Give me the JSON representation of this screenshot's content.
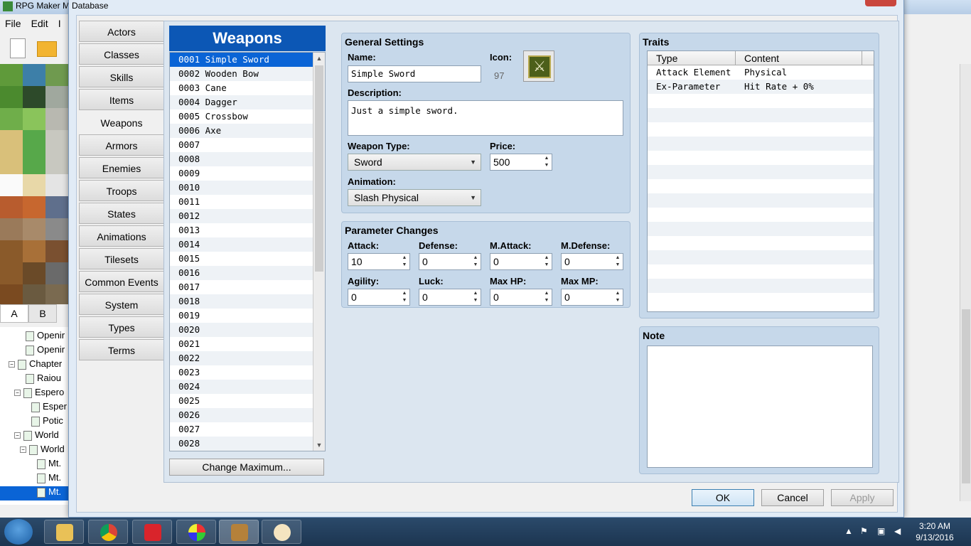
{
  "app": {
    "title": "RPG Maker M",
    "menu": [
      "File",
      "Edit",
      "I"
    ],
    "tile_tabs": [
      "A",
      "B"
    ],
    "tree_items": [
      {
        "label": "Openir",
        "indent": 36,
        "toggle": ""
      },
      {
        "label": "Openir",
        "indent": 36,
        "toggle": ""
      },
      {
        "label": "Chapter",
        "indent": 12,
        "toggle": "⊟"
      },
      {
        "label": "Raiou",
        "indent": 36,
        "toggle": ""
      },
      {
        "label": "Espero",
        "indent": 20,
        "toggle": "⊟"
      },
      {
        "label": "Esper",
        "indent": 44,
        "toggle": ""
      },
      {
        "label": "Potic",
        "indent": 44,
        "toggle": ""
      },
      {
        "label": "World",
        "indent": 20,
        "toggle": "⊟"
      },
      {
        "label": "World",
        "indent": 28,
        "toggle": "⊟"
      },
      {
        "label": "Mt.",
        "indent": 52,
        "toggle": ""
      },
      {
        "label": "Mt.",
        "indent": 52,
        "toggle": ""
      },
      {
        "label": "Mt.",
        "indent": 52,
        "toggle": "",
        "selected": true
      }
    ]
  },
  "dialog": {
    "title": "Database",
    "categories": [
      "Actors",
      "Classes",
      "Skills",
      "Items",
      "Weapons",
      "Armors",
      "Enemies",
      "Troops",
      "States",
      "Animations",
      "Tilesets",
      "Common Events",
      "System",
      "Types",
      "Terms"
    ],
    "active_category": "Weapons",
    "list_heading": "Weapons",
    "weapons": [
      "0001 Simple Sword",
      "0002 Wooden Bow",
      "0003 Cane",
      "0004 Dagger",
      "0005 Crossbow",
      "0006 Axe",
      "0007",
      "0008",
      "0009",
      "0010",
      "0011",
      "0012",
      "0013",
      "0014",
      "0015",
      "0016",
      "0017",
      "0018",
      "0019",
      "0020",
      "0021",
      "0022",
      "0023",
      "0024",
      "0025",
      "0026",
      "0027",
      "0028"
    ],
    "selected_index": 0,
    "change_max_label": "Change Maximum...",
    "general": {
      "title": "General Settings",
      "name_label": "Name:",
      "name_value": "Simple Sword",
      "icon_label": "Icon:",
      "icon_index": "97",
      "desc_label": "Description:",
      "desc_value": "Just a simple sword.",
      "wtype_label": "Weapon Type:",
      "wtype_value": "Sword",
      "price_label": "Price:",
      "price_value": "500",
      "anim_label": "Animation:",
      "anim_value": "Slash Physical"
    },
    "params": {
      "title": "Parameter Changes",
      "fields": [
        {
          "label": "Attack:",
          "value": "10"
        },
        {
          "label": "Defense:",
          "value": "0"
        },
        {
          "label": "M.Attack:",
          "value": "0"
        },
        {
          "label": "M.Defense:",
          "value": "0"
        },
        {
          "label": "Agility:",
          "value": "0"
        },
        {
          "label": "Luck:",
          "value": "0"
        },
        {
          "label": "Max HP:",
          "value": "0"
        },
        {
          "label": "Max MP:",
          "value": "0"
        }
      ]
    },
    "traits": {
      "title": "Traits",
      "col_type": "Type",
      "col_content": "Content",
      "rows": [
        {
          "type": "Attack Element",
          "content": "Physical"
        },
        {
          "type": "Ex-Parameter",
          "content": "Hit Rate + 0%"
        }
      ]
    },
    "note": {
      "title": "Note",
      "value": ""
    },
    "buttons": {
      "ok": "OK",
      "cancel": "Cancel",
      "apply": "Apply"
    }
  },
  "taskbar": {
    "time": "3:20 AM",
    "date": "9/13/2016",
    "apps": [
      "file-explorer",
      "chrome",
      "gamepad",
      "paint-ball",
      "rpg-maker",
      "paint-palette"
    ]
  },
  "colors": {
    "selection": "#0a64d6",
    "heading": "#0c57b5",
    "group_bg": "#c6d8ea"
  }
}
